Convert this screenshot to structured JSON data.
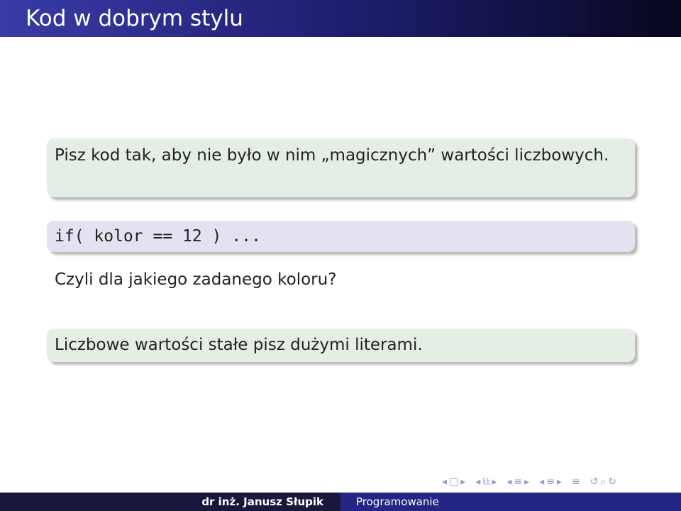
{
  "slide": {
    "title": "Kod w dobrym stylu",
    "block1_text": "Pisz kod tak, aby nie było w nim „magicznych” wartości liczbowych.",
    "code_text": "if( kolor == 12 ) ...",
    "question_text": "Czyli dla jakiego zadanego koloru?",
    "block3_text": "Liczbowe wartości stałe pisz dużymi literami."
  },
  "footer": {
    "author": "dr inż. Janusz Słupik",
    "course": "Programowanie"
  },
  "navigation": {
    "icons": [
      "nav-prev-frame-icon",
      "nav-next-frame-icon",
      "nav-prev-slide-icon",
      "nav-next-slide-icon",
      "nav-prev-section-icon",
      "nav-next-section-icon",
      "nav-prev-subsection-icon",
      "nav-next-subsection-icon",
      "nav-align-icon",
      "nav-search-icon"
    ]
  }
}
